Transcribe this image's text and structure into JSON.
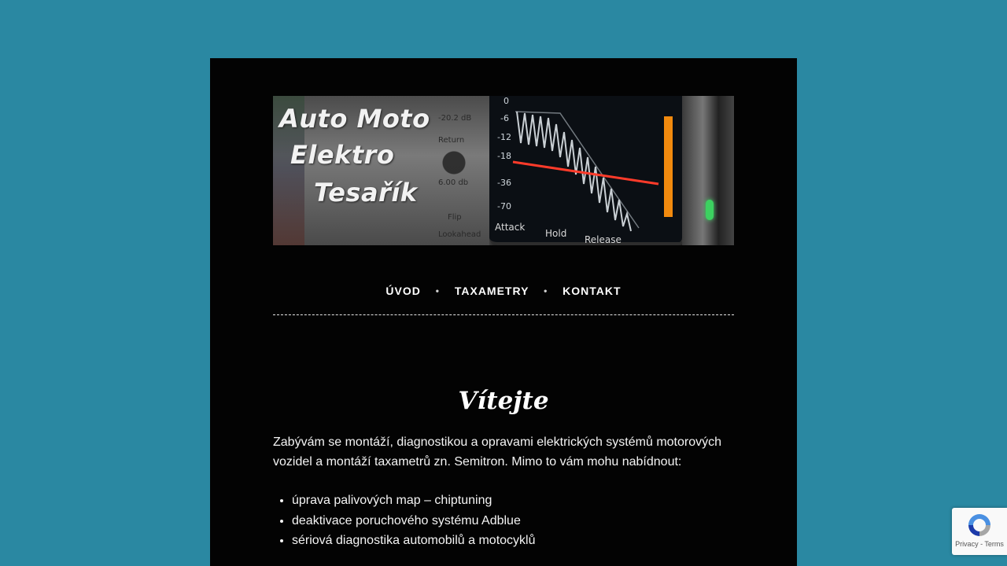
{
  "banner": {
    "line1": "Auto Moto",
    "line2": "Elektro",
    "line3": "Tesařík",
    "meter_scale": [
      "0",
      "-6",
      "-12",
      "-18",
      "-36",
      "-70"
    ],
    "knob_labels": [
      "-20.2 dB",
      "Return",
      "6.00 db",
      "Flip",
      "Lookahead"
    ],
    "panel_labels": [
      "Attack",
      "Hold",
      "Release"
    ]
  },
  "nav": {
    "items": [
      "ÚVOD",
      "TAXAMETRY",
      "KONTAKT"
    ],
    "separator": "•"
  },
  "content": {
    "heading": "Vítejte",
    "intro": "Zabývám se montáží, diagnostikou a opravami elektrických systémů motorových vozidel a montáží taxametrů zn. Semitron. Mimo to vám mohu nabídnout:",
    "services": [
      "úprava palivových map – chiptuning",
      "deaktivace poruchového systému Adblue",
      "sériová diagnostika automobilů a motocyklů"
    ]
  },
  "recaptcha": {
    "privacy": "Privacy",
    "sep": " - ",
    "terms": "Terms"
  },
  "colors": {
    "background": "#2a88a2",
    "page": "#030303",
    "text": "#f4f4f4",
    "meter_orange": "#f28a0e",
    "meter_red": "#ff3b2a",
    "led_green": "#3cd160"
  }
}
